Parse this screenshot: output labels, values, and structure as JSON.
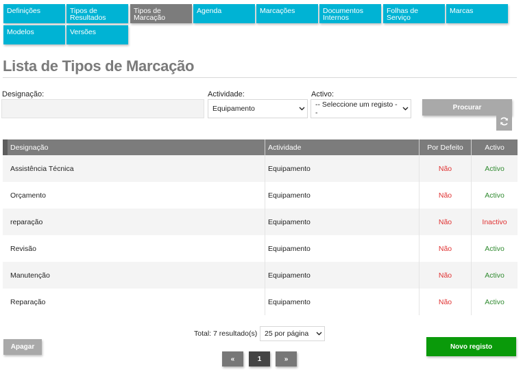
{
  "nav": {
    "tabs": [
      {
        "label": "Definições",
        "active": false
      },
      {
        "label": "Tipos de Resultados",
        "active": false
      },
      {
        "label": "Tipos de Marcação",
        "active": true
      },
      {
        "label": "Agenda",
        "active": false
      },
      {
        "label": "Marcações",
        "active": false
      },
      {
        "label": "Documentos Internos",
        "active": false
      },
      {
        "label": "Folhas de Serviço",
        "active": false
      },
      {
        "label": "Marcas",
        "active": false
      },
      {
        "label": "Modelos",
        "active": false
      },
      {
        "label": "Versões",
        "active": false
      }
    ]
  },
  "page": {
    "title": "Lista de Tipos de Marcação"
  },
  "filters": {
    "designacao_label": "Designação:",
    "designacao_value": "",
    "actividade_label": "Actividade:",
    "actividade_value": "Equipamento",
    "activo_label": "Activo:",
    "activo_value": "-- Seleccione um registo --",
    "procurar_label": "Procurar",
    "refresh_icon": "refresh-icon"
  },
  "table": {
    "columns": [
      "Designação",
      "Actividade",
      "Por Defeito",
      "Activo"
    ],
    "rows": [
      {
        "designacao": "Assistência Técnica",
        "actividade": "Equipamento",
        "por_defeito": "Não",
        "activo": "Activo"
      },
      {
        "designacao": "Orçamento",
        "actividade": "Equipamento",
        "por_defeito": "Não",
        "activo": "Activo"
      },
      {
        "designacao": "reparação",
        "actividade": "Equipamento",
        "por_defeito": "Não",
        "activo": "Inactivo"
      },
      {
        "designacao": "Revisão",
        "actividade": "Equipamento",
        "por_defeito": "Não",
        "activo": "Activo"
      },
      {
        "designacao": "Manutenção",
        "actividade": "Equipamento",
        "por_defeito": "Não",
        "activo": "Activo"
      },
      {
        "designacao": "Reparação",
        "actividade": "Equipamento",
        "por_defeito": "Não",
        "activo": "Activo"
      }
    ]
  },
  "footer": {
    "total": "Total: 7 resultado(s)",
    "page_size": "25 por página",
    "apagar_label": "Apagar",
    "novo_label": "Novo registo",
    "prev_label": "«",
    "current_page": "1",
    "next_label": "»"
  },
  "colors": {
    "tab": "#00b3d4",
    "tab_active": "#7c7c7c",
    "header": "#7c7c7c",
    "button_gray": "#a9a9a9",
    "button_green": "#0a9a0a",
    "status_red": "#e03131",
    "status_green": "#2f8a2f"
  }
}
